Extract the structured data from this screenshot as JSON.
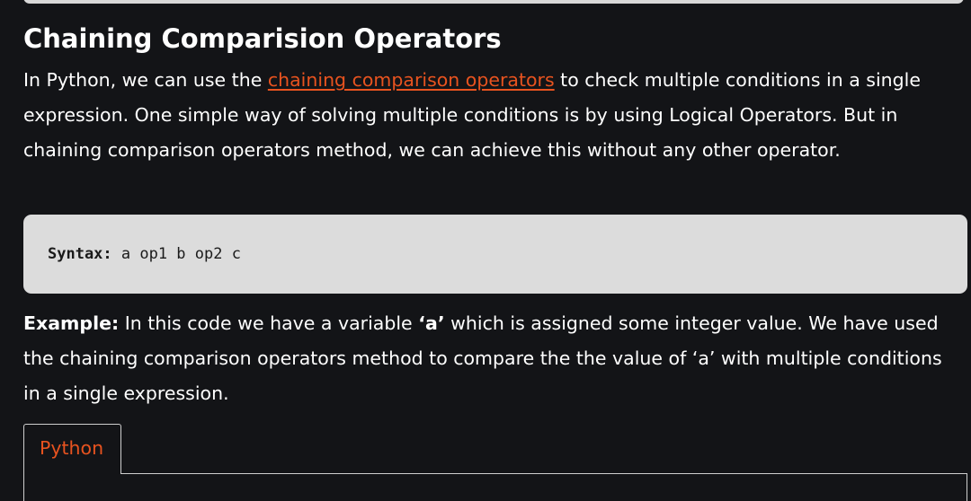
{
  "article": {
    "heading": "Chaining Comparision Operators",
    "intro": {
      "before_link": "In Python, we can use the ",
      "link_text": "chaining comparison operators",
      "after_link": " to check multiple conditions in a single expression. One simple way of solving multiple conditions is by using Logical Operators. But in chaining comparison operators method, we can achieve this without any other operator."
    },
    "syntax_block": {
      "label": "Syntax:",
      "code": " a op1 b op2 c"
    },
    "example": {
      "label": "Example:",
      "text_before_var": " In this code we have a variable ",
      "var_name": "‘a’",
      "text_after_var": " which is assigned some integer value. We have used the chaining comparison operators method to compare the the value of ‘a’ with multiple conditions in a single expression."
    },
    "code_tabs": [
      {
        "label": "Python",
        "active": true
      }
    ]
  },
  "colors": {
    "background": "#131417",
    "text": "#ffffff",
    "link": "#e8531f",
    "code_bg": "#dcdcdc"
  }
}
